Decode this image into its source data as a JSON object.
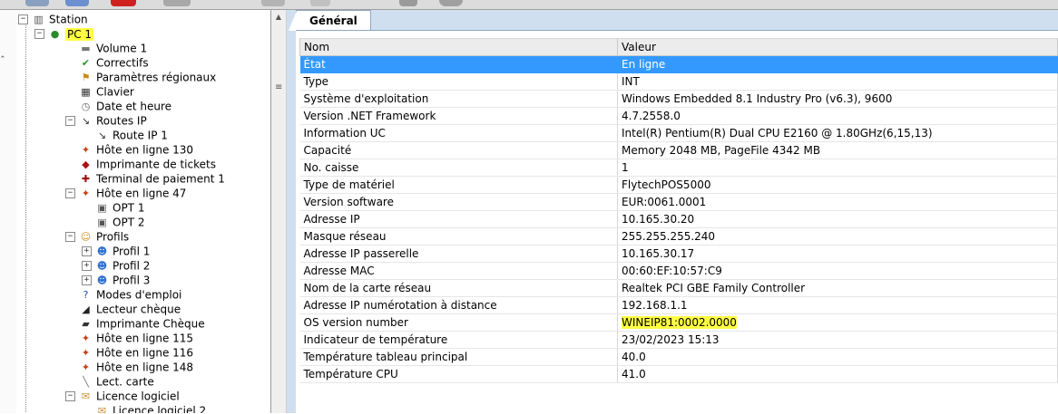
{
  "colors": {
    "selection": "#3399ff",
    "highlight": "#ffff44",
    "tab_area": "#cfdff0",
    "header_bg": "#ececec"
  },
  "tree": {
    "root": {
      "label": "Station",
      "icon": "station-icon"
    },
    "items": [
      {
        "label": "PC 1",
        "icon": "pc-bulb-icon",
        "toggle": "−",
        "level": 1,
        "highlighted": true
      },
      {
        "label": "Volume 1",
        "icon": "disk-icon",
        "level": 2
      },
      {
        "label": "Correctifs",
        "icon": "shield-check-icon",
        "level": 2
      },
      {
        "label": "Paramètres régionaux",
        "icon": "regional-settings-icon",
        "level": 2
      },
      {
        "label": "Clavier",
        "icon": "keyboard-icon",
        "level": 2
      },
      {
        "label": "Date et heure",
        "icon": "clock-icon",
        "level": 2
      },
      {
        "label": "Routes IP",
        "icon": "route-icon",
        "toggle": "−",
        "level": 2
      },
      {
        "label": "Route IP 1",
        "icon": "route-icon",
        "level": 3
      },
      {
        "label": "Hôte en ligne 130",
        "icon": "online-host-icon",
        "level": 2
      },
      {
        "label": "Imprimante de tickets",
        "icon": "ticket-printer-icon",
        "level": 2
      },
      {
        "label": "Terminal de paiement 1",
        "icon": "payment-terminal-icon",
        "level": 2
      },
      {
        "label": "Hôte en ligne 47",
        "icon": "online-host-icon",
        "toggle": "−",
        "level": 2
      },
      {
        "label": "OPT 1",
        "icon": "opt-terminal-icon",
        "level": 3
      },
      {
        "label": "OPT 2",
        "icon": "opt-terminal-icon",
        "level": 3
      },
      {
        "label": "Profils",
        "icon": "profiles-icon",
        "toggle": "−",
        "level": 2
      },
      {
        "label": "Profil 1",
        "icon": "profile-icon",
        "toggle": "+",
        "level": 3
      },
      {
        "label": "Profil 2",
        "icon": "profile-icon",
        "toggle": "+",
        "level": 3
      },
      {
        "label": "Profil 3",
        "icon": "profile-icon",
        "toggle": "+",
        "level": 3
      },
      {
        "label": "Modes d'emploi",
        "icon": "help-icon",
        "level": 2
      },
      {
        "label": "Lecteur chèque",
        "icon": "check-reader-icon",
        "level": 2
      },
      {
        "label": "Imprimante Chèque",
        "icon": "check-printer-icon",
        "level": 2
      },
      {
        "label": "Hôte en ligne 115",
        "icon": "online-host-icon",
        "level": 2
      },
      {
        "label": "Hôte en ligne 116",
        "icon": "online-host-icon",
        "level": 2
      },
      {
        "label": "Hôte en ligne 148",
        "icon": "online-host-icon",
        "level": 2
      },
      {
        "label": "Lect. carte",
        "icon": "card-reader-icon",
        "level": 2
      },
      {
        "label": "Licence logiciel",
        "icon": "license-icon",
        "toggle": "−",
        "level": 2
      },
      {
        "label": "Licence logiciel 2",
        "icon": "license-icon",
        "level": 3
      }
    ]
  },
  "tabs": [
    {
      "label": "Général",
      "active": true
    }
  ],
  "grid": {
    "headers": {
      "name": "Nom",
      "value": "Valeur"
    },
    "rows": [
      {
        "name": "État",
        "value": "En ligne",
        "selected": true
      },
      {
        "name": "Type",
        "value": "INT"
      },
      {
        "name": "Système d'exploitation",
        "value": "Windows Embedded 8.1 Industry Pro (v6.3), 9600"
      },
      {
        "name": "Version .NET Framework",
        "value": "4.7.2558.0"
      },
      {
        "name": "Information UC",
        "value": "Intel(R) Pentium(R) Dual CPU E2160 @ 1.80GHz(6,15,13)"
      },
      {
        "name": "Capacité",
        "value": "Memory 2048 MB, PageFile 4342 MB"
      },
      {
        "name": "No. caisse",
        "value": "1"
      },
      {
        "name": "Type de matériel",
        "value": "FlytechPOS5000"
      },
      {
        "name": "Version software",
        "value": "EUR:0061.0001"
      },
      {
        "name": "Adresse IP",
        "value": "10.165.30.20"
      },
      {
        "name": "Masque réseau",
        "value": "255.255.255.240"
      },
      {
        "name": "Adresse IP passerelle",
        "value": "10.165.30.17"
      },
      {
        "name": "Adresse MAC",
        "value": "00:60:EF:10:57:C9"
      },
      {
        "name": "Nom de la carte réseau",
        "value": "Realtek PCI GBE Family Controller"
      },
      {
        "name": "Adresse IP numérotation à distance",
        "value": "192.168.1.1"
      },
      {
        "name": "OS version number",
        "value": "WINEIP81:0002.0000",
        "highlighted": true
      },
      {
        "name": "Indicateur de température",
        "value": "23/02/2023 15:13"
      },
      {
        "name": "Température tableau principal",
        "value": "40.0"
      },
      {
        "name": "Température CPU",
        "value": "41.0"
      }
    ]
  }
}
